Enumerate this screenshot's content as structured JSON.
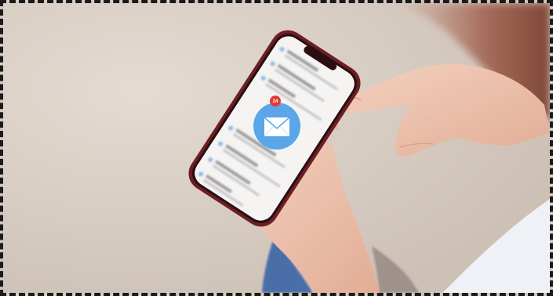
{
  "photo": {
    "subject": "hand-holding-smartphone-with-mail-notification",
    "notification": {
      "icon": "envelope-icon",
      "badge_count": "24",
      "badge_color": "#e53935",
      "circle_color": "#5aa6e8"
    },
    "colors": {
      "background": "#d8cec4",
      "phone_frame": "#6b1f24",
      "sleeve": "#eef1f6",
      "jeans": "#4a6ea8",
      "skin": "#efc5b0"
    }
  }
}
